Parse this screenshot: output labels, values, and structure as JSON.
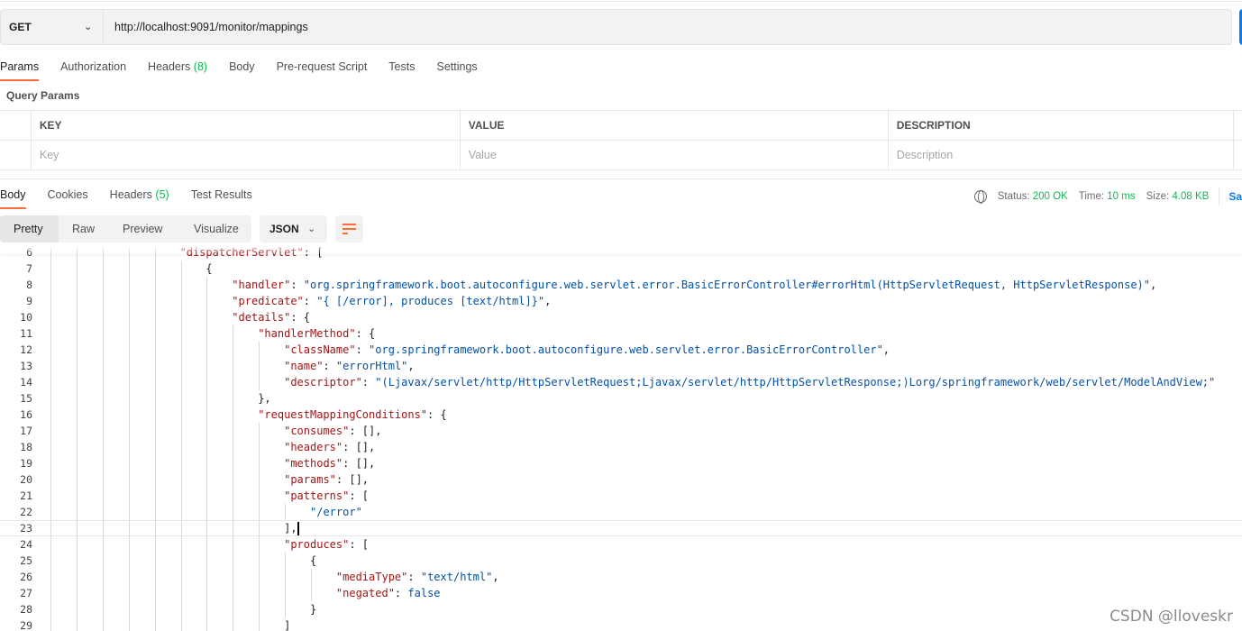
{
  "request": {
    "method": "GET",
    "url": "http://localhost:9091/monitor/mappings"
  },
  "request_tabs": [
    {
      "label": "Params",
      "active": true
    },
    {
      "label": "Authorization"
    },
    {
      "label": "Headers",
      "count": "(8)"
    },
    {
      "label": "Body"
    },
    {
      "label": "Pre-request Script"
    },
    {
      "label": "Tests"
    },
    {
      "label": "Settings"
    }
  ],
  "query_params": {
    "title": "Query Params",
    "columns": [
      "KEY",
      "VALUE",
      "DESCRIPTION"
    ],
    "placeholders": [
      "Key",
      "Value",
      "Description"
    ]
  },
  "response_tabs": [
    {
      "label": "Body",
      "active": true
    },
    {
      "label": "Cookies"
    },
    {
      "label": "Headers",
      "count": "(5)"
    },
    {
      "label": "Test Results"
    }
  ],
  "status": {
    "status_label": "Status:",
    "status": "200 OK",
    "time_label": "Time:",
    "time": "10 ms",
    "size_label": "Size:",
    "size": "4.08 KB",
    "save": "Sa"
  },
  "view_modes": [
    "Pretty",
    "Raw",
    "Preview",
    "Visualize"
  ],
  "format": "JSON",
  "colors": {
    "accent": "#ff6c37",
    "key": "#a31515",
    "string": "#0451a5",
    "success": "#0cbb52",
    "primary": "#097bed"
  },
  "code_lines": [
    {
      "n": "6",
      "indent": 5,
      "text": "\"dispatcherServlet\": ["
    },
    {
      "n": "7",
      "indent": 6,
      "text": "{"
    },
    {
      "n": "8",
      "indent": 7,
      "text": "\"handler\": \"org.springframework.boot.autoconfigure.web.servlet.error.BasicErrorController#errorHtml(HttpServletRequest, HttpServletResponse)\","
    },
    {
      "n": "9",
      "indent": 7,
      "text": "\"predicate\": \"{ [/error], produces [text/html]}\","
    },
    {
      "n": "10",
      "indent": 7,
      "text": "\"details\": {"
    },
    {
      "n": "11",
      "indent": 8,
      "text": "\"handlerMethod\": {"
    },
    {
      "n": "12",
      "indent": 9,
      "text": "\"className\": \"org.springframework.boot.autoconfigure.web.servlet.error.BasicErrorController\","
    },
    {
      "n": "13",
      "indent": 9,
      "text": "\"name\": \"errorHtml\","
    },
    {
      "n": "14",
      "indent": 9,
      "text": "\"descriptor\": \"(Ljavax/servlet/http/HttpServletRequest;Ljavax/servlet/http/HttpServletResponse;)Lorg/springframework/web/servlet/ModelAndView;\""
    },
    {
      "n": "15",
      "indent": 8,
      "text": "},"
    },
    {
      "n": "16",
      "indent": 8,
      "text": "\"requestMappingConditions\": {"
    },
    {
      "n": "17",
      "indent": 9,
      "text": "\"consumes\": [],"
    },
    {
      "n": "18",
      "indent": 9,
      "text": "\"headers\": [],"
    },
    {
      "n": "19",
      "indent": 9,
      "text": "\"methods\": [],"
    },
    {
      "n": "20",
      "indent": 9,
      "text": "\"params\": [],"
    },
    {
      "n": "21",
      "indent": 9,
      "text": "\"patterns\": ["
    },
    {
      "n": "22",
      "indent": 10,
      "text": "\"/error\""
    },
    {
      "n": "23",
      "indent": 9,
      "text": "],",
      "cursor": true
    },
    {
      "n": "24",
      "indent": 9,
      "text": "\"produces\": ["
    },
    {
      "n": "25",
      "indent": 10,
      "text": "{"
    },
    {
      "n": "26",
      "indent": 11,
      "text": "\"mediaType\": \"text/html\","
    },
    {
      "n": "27",
      "indent": 11,
      "text": "\"negated\": false"
    },
    {
      "n": "28",
      "indent": 10,
      "text": "}"
    },
    {
      "n": "29",
      "indent": 9,
      "text": "]"
    }
  ],
  "watermark": "CSDN @lloveskr"
}
